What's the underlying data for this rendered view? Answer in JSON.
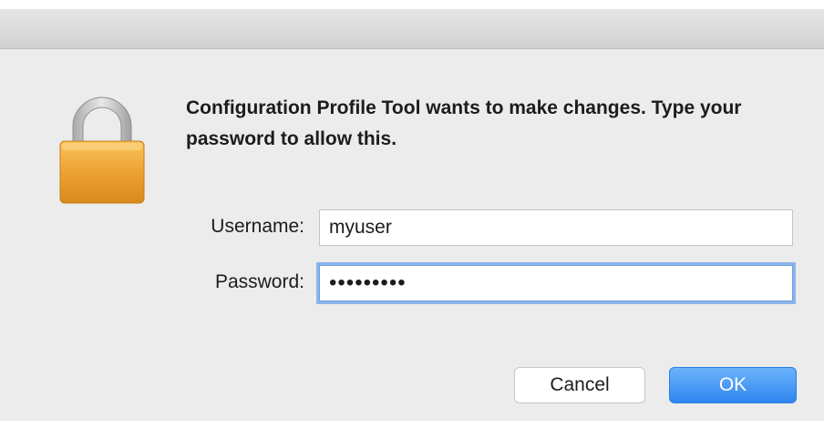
{
  "dialog": {
    "message": "Configuration Profile Tool wants to make changes. Type your password to allow this.",
    "icon": "lock-icon"
  },
  "form": {
    "username_label": "Username:",
    "username_value": "myuser",
    "password_label": "Password:",
    "password_value": "•••••••••"
  },
  "buttons": {
    "cancel_label": "Cancel",
    "ok_label": "OK"
  },
  "colors": {
    "accent": "#2f86f0",
    "lock_body": "#eea233",
    "lock_shackle": "#c9c9c9"
  }
}
